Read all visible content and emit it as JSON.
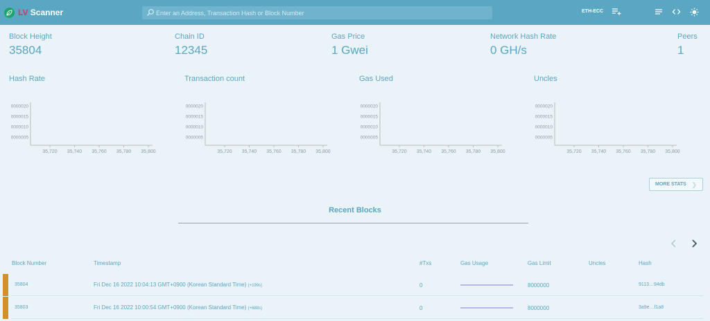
{
  "app": {
    "brand_prefix": "LV",
    "brand_suffix": "Scanner"
  },
  "search": {
    "placeholder": "Enter an Address, Transaction Hash or Block Number"
  },
  "network": {
    "name": "ETH-ECC"
  },
  "stats": [
    {
      "label": "Block Height",
      "value": "35804"
    },
    {
      "label": "Chain ID",
      "value": "12345"
    },
    {
      "label": "Gas Price",
      "value": "1 Gwei"
    },
    {
      "label": "Network Hash Rate",
      "value": "0 GH/s"
    },
    {
      "label": "Peers",
      "value": "1"
    }
  ],
  "charts": {
    "titles": [
      "Hash Rate",
      "Transaction count",
      "Gas Used",
      "Uncles"
    ],
    "y_ticks": [
      "0000020",
      "0000015",
      "0000010",
      "0000005"
    ],
    "x_ticks": [
      "35,720",
      "35,740",
      "35,760",
      "35,780",
      "35,800"
    ]
  },
  "more_stats": {
    "label": "MORE STATS"
  },
  "recent_blocks": {
    "title": "Recent Blocks",
    "columns": [
      "Block Number",
      "Timestamp",
      "#Txs",
      "Gas Usage",
      "Gas Limit",
      "Uncles",
      "Hash"
    ],
    "rows": [
      {
        "number": "35804",
        "timestamp": "Fri Dec 16 2022 10:04:13 GMT+0900 (Korean Standard Time)",
        "ago": "(+199s)",
        "txs": "0",
        "gas_usage": 0,
        "gas_limit": "8000000",
        "uncles": "",
        "hash": "9113…94db"
      },
      {
        "number": "35803",
        "timestamp": "Fri Dec 16 2022 10:00:54 GMT+0900 (Korean Standard Time)",
        "ago": "(+688s)",
        "txs": "0",
        "gas_usage": 0,
        "gas_limit": "8000000",
        "uncles": "",
        "hash": "3a9e…f1a8"
      }
    ]
  },
  "colors": {
    "header": "#5aa7c3",
    "accent": "#5aa5c2",
    "row_marker": "#d28f2a",
    "logo": "#1fa36a",
    "brand_lv": "#d9346c",
    "background": "#eaf3f8"
  },
  "icons": [
    "leaf-logo-icon",
    "search-icon",
    "playlist-add-icon",
    "menu-icon",
    "code-icon",
    "sun-icon",
    "chevron-left-icon",
    "chevron-right-icon"
  ]
}
